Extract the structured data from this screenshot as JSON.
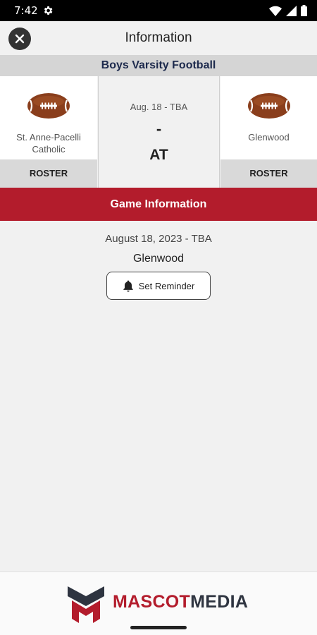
{
  "status_bar": {
    "time": "7:42"
  },
  "app_bar": {
    "title": "Information"
  },
  "event": {
    "sport": "Boys Varsity Football"
  },
  "matchup": {
    "left_team": {
      "name": "St. Anne-Pacelli Catholic",
      "roster_label": "ROSTER",
      "logo": "football-icon"
    },
    "right_team": {
      "name": "Glenwood",
      "roster_label": "ROSTER",
      "logo": "football-icon"
    },
    "date_short": "Aug. 18 - TBA",
    "score": "-",
    "versus": "AT"
  },
  "game_info": {
    "section_title": "Game Information",
    "date_long": "August 18, 2023 - TBA",
    "location": "Glenwood",
    "reminder_label": "Set Reminder"
  },
  "footer": {
    "brand_part1": "MASCOT",
    "brand_part2": "MEDIA"
  },
  "colors": {
    "accent_red": "#b31c2c",
    "navy": "#1d2a4d"
  }
}
